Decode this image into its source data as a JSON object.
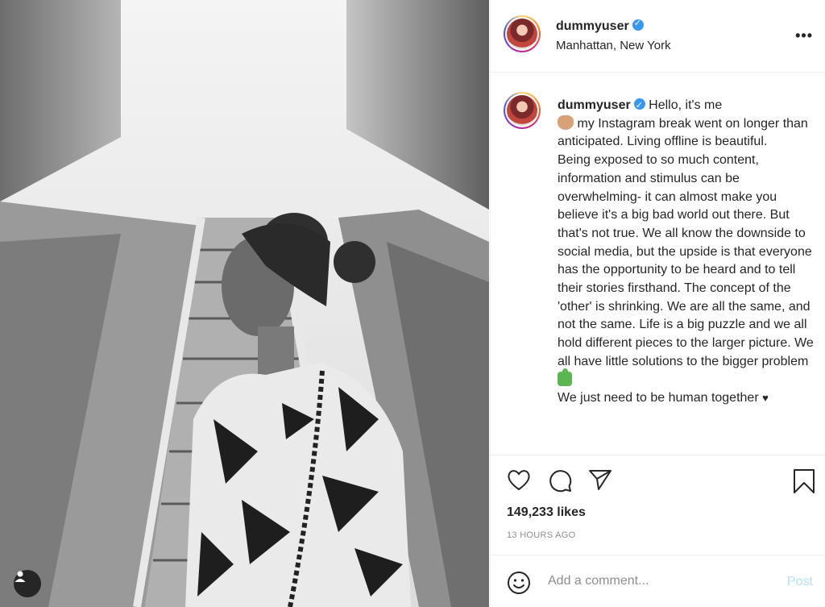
{
  "post": {
    "username": "dummyuser",
    "location": "Manhattan, New York",
    "more_label": "•••"
  },
  "caption": {
    "username": "dummyuser",
    "lines": [
      "Hello, it's me",
      "my Instagram break went on longer than anticipated. Living offline is beautiful.",
      "Being exposed to so much content, information and stimulus can be overwhelming- it can almost make you believe it's a big bad world out there. But that's not true. We all know the downside to social media, but the upside is that everyone has the opportunity to be heard and to tell their stories firsthand. The concept of the 'other' is shrinking. We are all the same, and not the same. Life is a big puzzle and we all hold different pieces to the larger picture. We all have little solutions to the bigger problem",
      "We just need to be human together",
      "♥"
    ]
  },
  "stats": {
    "likes": "149,233 likes",
    "time": "13 HOURS AGO"
  },
  "comment": {
    "placeholder": "Add a comment...",
    "post_label": "Post"
  },
  "icons": {
    "like": "heart-icon",
    "comment": "comment-bubble-icon",
    "share": "paper-plane-icon",
    "save": "bookmark-icon",
    "emoji": "smiley-icon",
    "tag": "user-tag-icon",
    "verified": "verified-badge-icon"
  },
  "colors": {
    "verified": "#3897f0",
    "post_disabled": "#b2dffc",
    "muted": "#8e8e8e",
    "text": "#262626"
  }
}
